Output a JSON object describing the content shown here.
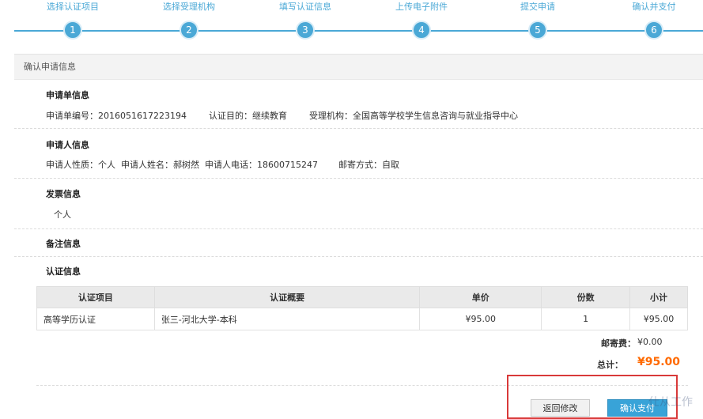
{
  "steps": [
    {
      "label": "选择认证项目",
      "num": "1"
    },
    {
      "label": "选择受理机构",
      "num": "2"
    },
    {
      "label": "填写认证信息",
      "num": "3"
    },
    {
      "label": "上传电子附件",
      "num": "4"
    },
    {
      "label": "提交申请",
      "num": "5"
    },
    {
      "label": "确认并支付",
      "num": "6"
    }
  ],
  "panel": {
    "title": "确认申请信息"
  },
  "application": {
    "title": "申请单信息",
    "number": "申请单编号：2016051617223194",
    "purpose": "认证目的：继续教育",
    "agency": "受理机构：全国高等学校学生信息咨询与就业指导中心"
  },
  "applicant": {
    "title": "申请人信息",
    "details": "申请人性质：个人  申请人姓名：郝树然  申请人电话：18600715247",
    "mail": "邮寄方式：自取"
  },
  "invoice": {
    "title": "发票信息",
    "value": "个人"
  },
  "remarks": {
    "title": "备注信息"
  },
  "certification": {
    "title": "认证信息",
    "headers": [
      "认证项目",
      "认证概要",
      "单价",
      "份数",
      "小计"
    ],
    "rows": [
      {
        "item": "高等学历认证",
        "summary": "张三-河北大学-本科",
        "price": "¥95.00",
        "qty": "1",
        "subtotal": "¥95.00"
      }
    ],
    "postage_label": "邮寄费：",
    "postage_value": "¥0.00",
    "total_label": "总计：",
    "total_value": "¥95.00"
  },
  "buttons": {
    "back": "返回修改",
    "pay": "确认支付"
  },
  "watermark": "仕从工作"
}
